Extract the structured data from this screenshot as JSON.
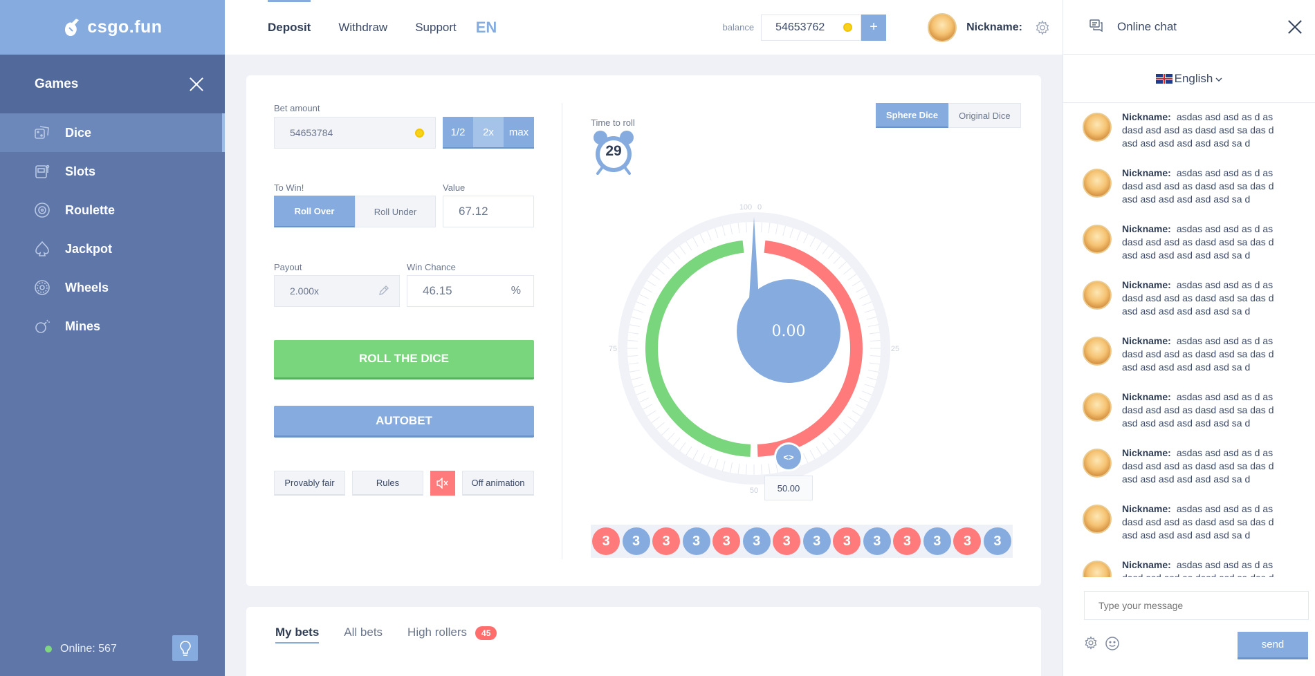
{
  "brand": {
    "logo_text": "csgo.fun"
  },
  "sidebar": {
    "title": "Games",
    "items": [
      {
        "label": "Dice",
        "icon": "dice-icon",
        "active": true
      },
      {
        "label": "Slots",
        "icon": "slot-machine-icon"
      },
      {
        "label": "Roulette",
        "icon": "roulette-icon"
      },
      {
        "label": "Jackpot",
        "icon": "spade-icon"
      },
      {
        "label": "Wheels",
        "icon": "wheel-icon"
      },
      {
        "label": "Mines",
        "icon": "bomb-icon"
      }
    ],
    "online": "Online: 567"
  },
  "header": {
    "nav": [
      "Deposit",
      "Withdraw",
      "Support"
    ],
    "lang": "EN",
    "balance_label": "balance",
    "balance": "54653762",
    "plus": "+",
    "nickname": "Nickname:"
  },
  "game": {
    "bet_amount_label": "Bet amount",
    "bet_amount": "54653784",
    "quick": [
      "1/2",
      "2x",
      "max"
    ],
    "to_win_label": "To Win!",
    "roll_over": "Roll Over",
    "roll_under": "Roll Under",
    "value_label": "Value",
    "value": "67.12",
    "payout_label": "Payout",
    "payout": "2.000x",
    "win_chance_label": "Win Chance",
    "win_chance": "46.15",
    "percent": "%",
    "roll_btn": "ROLL THE DICE",
    "autobet_btn": "AUTOBET",
    "provably_fair": "Provably fair",
    "rules": "Rules",
    "off_animation": "Off animation",
    "time_to_roll_label": "Time to roll",
    "time_to_roll": "29",
    "tabs": [
      "Sphere Dice",
      "Original Dice"
    ],
    "result": "0.00",
    "handle_symbol": "<>",
    "handle_value": "50.00",
    "dial_labels": {
      "top_left": "100",
      "top_right": "0",
      "left": "75",
      "right": "25",
      "bottom": "50"
    },
    "green_color": "#79d67d",
    "red_color": "#ff7b7b",
    "accent": "#86acdf",
    "history": [
      {
        "v": "3",
        "c": "red"
      },
      {
        "v": "3",
        "c": "blue"
      },
      {
        "v": "3",
        "c": "red"
      },
      {
        "v": "3",
        "c": "blue"
      },
      {
        "v": "3",
        "c": "red"
      },
      {
        "v": "3",
        "c": "blue"
      },
      {
        "v": "3",
        "c": "red"
      },
      {
        "v": "3",
        "c": "blue"
      },
      {
        "v": "3",
        "c": "red"
      },
      {
        "v": "3",
        "c": "blue"
      },
      {
        "v": "3",
        "c": "red"
      },
      {
        "v": "3",
        "c": "blue"
      },
      {
        "v": "3",
        "c": "red"
      },
      {
        "v": "3",
        "c": "blue"
      }
    ]
  },
  "bets": {
    "tabs": [
      "My bets",
      "All bets",
      "High rollers"
    ],
    "high_rollers_badge": "45"
  },
  "chat": {
    "title": "Online chat",
    "language": "English",
    "messages": [
      {
        "nick": "Nickname:",
        "text": "asdas asd asd as d as dasd asd asd as dasd asd sa das d asd asd asd asd asd asd sa d"
      },
      {
        "nick": "Nickname:",
        "text": "asdas asd asd as d as dasd asd asd as dasd asd sa das d asd asd asd asd asd asd sa d"
      },
      {
        "nick": "Nickname:",
        "text": "asdas asd asd as d as dasd asd asd as dasd asd sa das d asd asd asd asd asd asd sa d"
      },
      {
        "nick": "Nickname:",
        "text": "asdas asd asd as d as dasd asd asd as dasd asd sa das d asd asd asd asd asd asd sa d"
      },
      {
        "nick": "Nickname:",
        "text": "asdas asd asd as d as dasd asd asd as dasd asd sa das d asd asd asd asd asd asd sa d"
      },
      {
        "nick": "Nickname:",
        "text": "asdas asd asd as d as dasd asd asd as dasd asd sa das d asd asd asd asd asd asd sa d"
      },
      {
        "nick": "Nickname:",
        "text": "asdas asd asd as d as dasd asd asd as dasd asd sa das d asd asd asd asd asd asd sa d"
      },
      {
        "nick": "Nickname:",
        "text": "asdas asd asd as d as dasd asd asd as dasd asd sa das d asd asd asd asd asd asd sa d"
      },
      {
        "nick": "Nickname:",
        "text": "asdas asd asd as d as dasd asd asd as dasd asd sa das d asd asd asd asd asd asd sa d"
      }
    ],
    "placeholder": "Type your message",
    "send": "send"
  }
}
